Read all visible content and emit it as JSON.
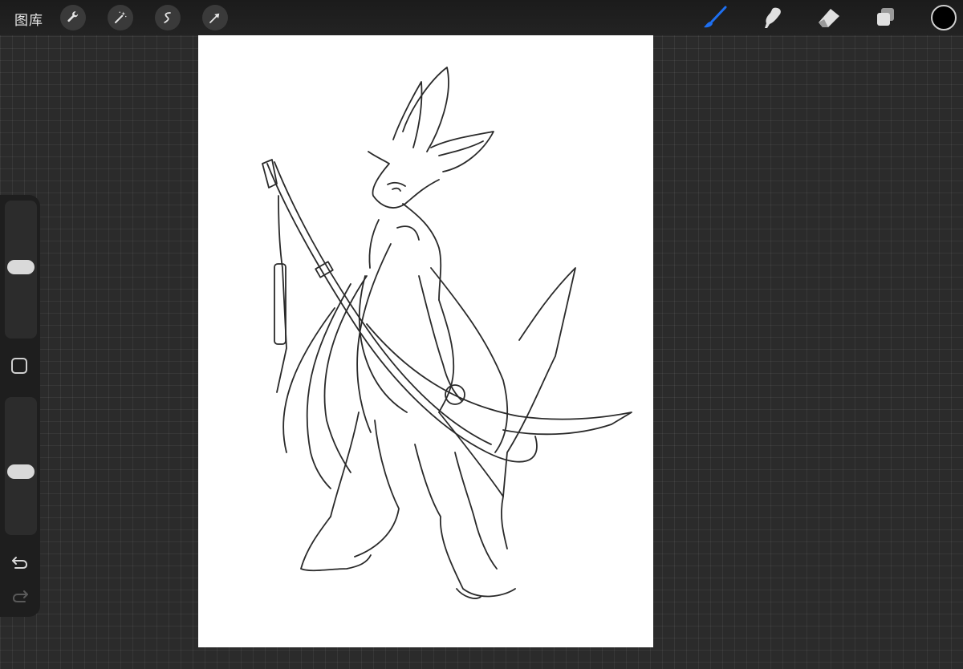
{
  "topbar": {
    "gallery_label": "图库",
    "left_tools": [
      "wrench-icon",
      "magic-wand-icon",
      "selection-icon",
      "transform-arrow-icon"
    ],
    "right_tools": [
      "brush-icon",
      "smudge-icon",
      "eraser-icon",
      "layers-icon"
    ],
    "active_tool": "brush-icon",
    "accent_color": "#1e6ff0",
    "current_color": "#000000"
  },
  "sidebar": {
    "brush_size_level": 0.55,
    "opacity_level": 0.45,
    "icons": [
      "modify-square-icon",
      "undo-icon",
      "redo-icon"
    ]
  },
  "canvas": {
    "background": "#ffffff",
    "content": "line-art sketch"
  }
}
